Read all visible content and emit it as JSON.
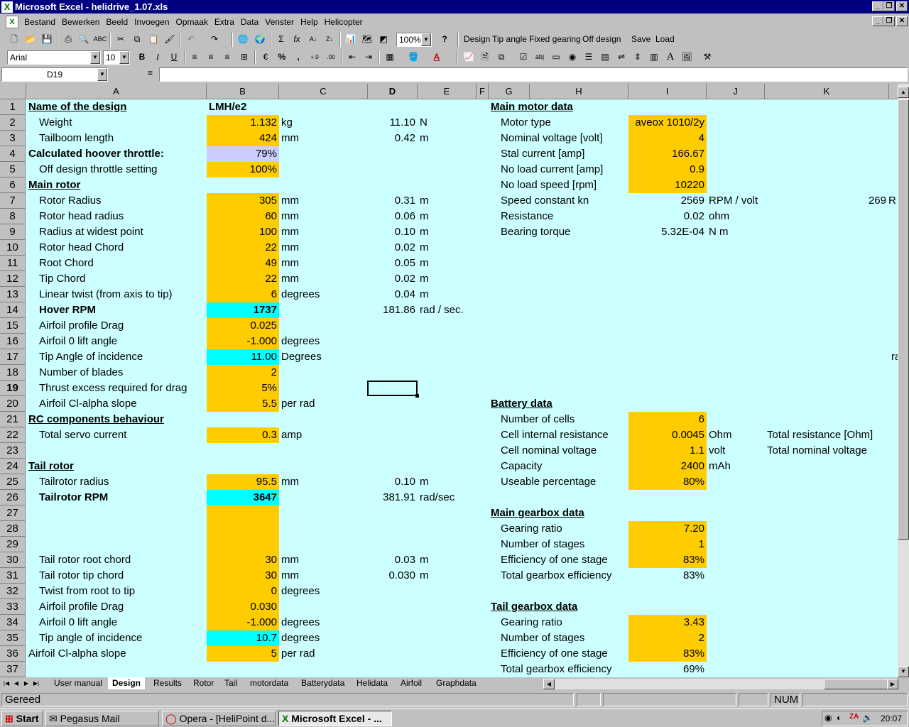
{
  "window": {
    "title": "Microsoft Excel - helidrive_1.07.xls"
  },
  "menu": [
    "Bestand",
    "Bewerken",
    "Beeld",
    "Invoegen",
    "Opmaak",
    "Extra",
    "Data",
    "Venster",
    "Help",
    "Helicopter"
  ],
  "toolbar": {
    "zoom": "100%",
    "font": "Arial",
    "size": "10",
    "macros": [
      "Design",
      "Tip angle",
      "Fixed gearing",
      "Off design",
      "Save",
      "Load"
    ]
  },
  "formula_bar": {
    "name_box": "D19",
    "equals": "=",
    "value": ""
  },
  "columns": [
    "A",
    "B",
    "C",
    "D",
    "E",
    "F",
    "G",
    "H",
    "I",
    "J",
    "K"
  ],
  "rows": [
    "1",
    "2",
    "3",
    "4",
    "5",
    "6",
    "7",
    "8",
    "9",
    "10",
    "11",
    "12",
    "13",
    "14",
    "15",
    "16",
    "17",
    "18",
    "19",
    "20",
    "21",
    "22",
    "23",
    "24",
    "25",
    "26",
    "27",
    "28",
    "29",
    "30",
    "31",
    "32",
    "33",
    "34",
    "35",
    "36",
    "37"
  ],
  "cells": {
    "r1": {
      "a": "Name of the design",
      "b": "LMH/e2",
      "g": "Main motor data"
    },
    "r2": {
      "a": "Weight",
      "b": "1.132",
      "c": "kg",
      "d": "11.10",
      "e": "N",
      "h": "Motor type",
      "i": "aveox 1010/2y"
    },
    "r3": {
      "a": "Tailboom length",
      "b": "424",
      "c": "mm",
      "d": "0.42",
      "e": "m",
      "h": "Nominal voltage [volt]",
      "i": "4"
    },
    "r4": {
      "a": "Calculated hoover throttle:",
      "b": "79%",
      "h": "Stal current [amp]",
      "i": "166.67"
    },
    "r5": {
      "a": "Off design throttle setting",
      "b": "100%",
      "h": "No load current [amp]",
      "i": "0.9"
    },
    "r6": {
      "a": "Main rotor",
      "h": "No load speed  [rpm]",
      "i": "10220"
    },
    "r7": {
      "a": "Rotor Radius",
      "b": "305",
      "c": "mm",
      "d": "0.31",
      "e": "m",
      "h": "Speed constant kn",
      "i": "2569",
      "j": "RPM / volt",
      "k": "269",
      "k2": "R"
    },
    "r8": {
      "a": "Rotor head radius",
      "b": "60",
      "c": "mm",
      "d": "0.06",
      "e": "m",
      "h": "Resistance",
      "i": "0.02",
      "j": "ohm"
    },
    "r9": {
      "a": "Radius at widest point",
      "b": "100",
      "c": "mm",
      "d": "0.10",
      "e": "m",
      "h": "Bearing torque",
      "i": "5.32E-04",
      "j": "N m"
    },
    "r10": {
      "a": "Rotor head Chord",
      "b": "22",
      "c": "mm",
      "d": "0.02",
      "e": "m"
    },
    "r11": {
      "a": "Root Chord",
      "b": "49",
      "c": "mm",
      "d": "0.05",
      "e": "m"
    },
    "r12": {
      "a": "Tip Chord",
      "b": "22",
      "c": "mm",
      "d": "0.02",
      "e": "m"
    },
    "r13": {
      "a": "Linear twist (from axis to tip)",
      "b": "6",
      "c": "degrees",
      "d": "0.04",
      "e": "m"
    },
    "r14": {
      "a": "Hover RPM",
      "b": "1737",
      "d": "181.86",
      "e": "rad /  sec."
    },
    "r15": {
      "a": "Airfoil profile Drag",
      "b": "0.025"
    },
    "r16": {
      "a": "Airfoil 0 lift angle",
      "b": "-1.000",
      "c": "degrees"
    },
    "r17": {
      "a": "Tip Angle of incidence",
      "b": "11.00",
      "c": "Degrees",
      "k": "ra"
    },
    "r18": {
      "a": "Number of blades",
      "b": "2"
    },
    "r19": {
      "a": "Thrust excess required for drag",
      "b": "5%"
    },
    "r20": {
      "a": "Airfoil Cl-alpha slope",
      "b": "5.5",
      "c": "per rad",
      "g": "Battery data"
    },
    "r21": {
      "a": "RC components behaviour",
      "h": "Number of cells",
      "i": "6"
    },
    "r22": {
      "a": "Total servo current",
      "b": "0.3",
      "c": "amp",
      "h": "Cell internal resistance",
      "i": "0.0045",
      "j": "Ohm",
      "k": "Total resistance [Ohm]"
    },
    "r23": {
      "h": "Cell nominal voltage",
      "i": "1.1",
      "j": "volt",
      "k": "Total nominal voltage"
    },
    "r24": {
      "a": "Tail rotor",
      "h": "Capacity",
      "i": "2400",
      "j": "mAh"
    },
    "r25": {
      "a": "Tailrotor radius",
      "b": "95.5",
      "c": "mm",
      "d": "0.10",
      "e": "m",
      "h": "Useable percentage",
      "i": "80%"
    },
    "r26": {
      "a": "Tailrotor RPM",
      "b": "3647",
      "d": "381.91",
      "e": "rad/sec"
    },
    "r27": {
      "g": "Main gearbox data"
    },
    "r28": {
      "h": "Gearing ratio",
      "i": "7.20"
    },
    "r29": {
      "h": "Number of stages",
      "i": "1"
    },
    "r30": {
      "a": "Tail rotor root chord",
      "b": "30",
      "c": "mm",
      "d": "0.03",
      "e": "m",
      "h": "Efficiency of one stage",
      "i": "83%"
    },
    "r31": {
      "a": "Tail rotor tip chord",
      "b": "30",
      "c": "mm",
      "d": "0.030",
      "e": "m",
      "h": "Total gearbox efficiency",
      "i": "83%"
    },
    "r32": {
      "a": "Twist from root to tip",
      "b": "0",
      "c": "degrees"
    },
    "r33": {
      "a": "Airfoil profile Drag",
      "b": "0.030",
      "g": "Tail gearbox data"
    },
    "r34": {
      "a": "Airfoil 0 lift angle",
      "b": "-1.000",
      "c": "degrees",
      "h": "Gearing ratio",
      "i": "3.43"
    },
    "r35": {
      "a": "Tip angle of incidence",
      "b": "10.7",
      "c": "degrees",
      "h": "Number of stages",
      "i": "2"
    },
    "r36": {
      "a": "Airfoil Cl-alpha slope",
      "b": "5",
      "c": "per rad",
      "h": "Efficiency of one stage",
      "i": "83%"
    },
    "r37": {
      "h": "Total gearbox efficiency",
      "i": "69%"
    }
  },
  "sheet_tabs": [
    "User manual",
    "Design",
    "Results",
    "Rotor",
    "Tail",
    "motordata",
    "Batterydata",
    "Helidata",
    "Airfoil",
    "Graphdata"
  ],
  "status": {
    "text": "Gereed",
    "num": "NUM"
  },
  "taskbar": {
    "start": "Start",
    "tasks": [
      "Pegasus Mail",
      "Opera - [HeliPoint d...",
      "Microsoft Excel - ..."
    ],
    "clock": "20:07"
  },
  "colors": {
    "input_fill": "#ffcc00",
    "highlight_fill": "#00ffff",
    "calc_fill": "#ccccff",
    "sheet_bg": "#ccffff",
    "titlebar": "#000080"
  }
}
